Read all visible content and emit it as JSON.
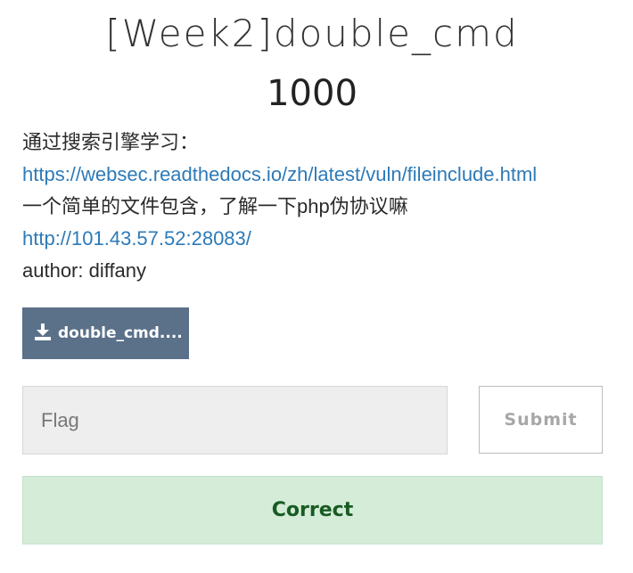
{
  "challenge": {
    "title": "[Week2]double_cmd",
    "points": "1000",
    "description": {
      "line1": "通过搜索引擎学习：",
      "link1": "https://websec.readthedocs.io/zh/latest/vuln/fileinclude.html",
      "line2": "一个简单的文件包含，了解一下php伪协议嘛",
      "link2": "http://101.43.57.52:28083/",
      "author": "author: diffany"
    },
    "attachment": {
      "icon": "download-icon",
      "label": "double_cmd...."
    }
  },
  "form": {
    "flag_placeholder": "Flag",
    "flag_value": "",
    "submit_label": "Submit"
  },
  "result": {
    "message": "Correct",
    "color": "#d5ecd9"
  }
}
